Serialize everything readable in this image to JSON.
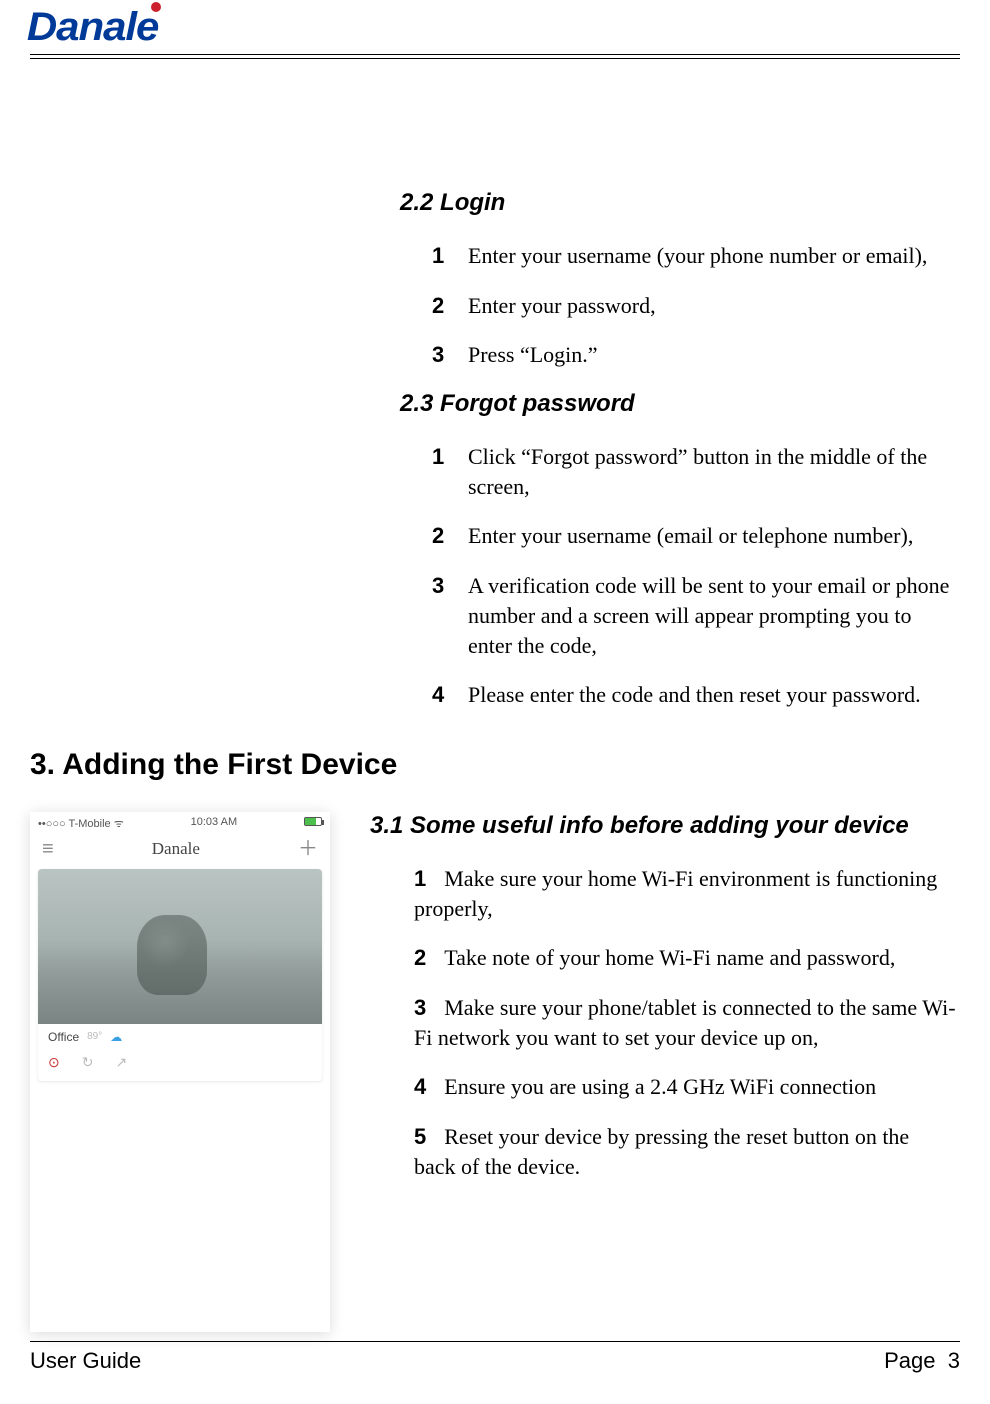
{
  "header": {
    "brand": "Danale"
  },
  "section22": {
    "heading": "2.2 Login",
    "items": [
      "Enter your username (your phone number or email),",
      "Enter your password,",
      "Press “Login.”"
    ]
  },
  "section23": {
    "heading": "2.3 Forgot password",
    "items": [
      "Click “Forgot password” button in the middle of the screen,",
      "Enter your username (email or telephone number),",
      "A verification code will be sent to your email or phone number and a screen will appear prompting you to enter the code,",
      "Please enter the code and then reset your password."
    ]
  },
  "section3": {
    "heading": "3. Adding the First Device"
  },
  "section31": {
    "heading": "3.1 Some useful info before adding your device",
    "items": [
      "Make sure your home Wi-Fi environment is functioning properly,",
      "Take note of your home Wi-Fi name and password,",
      "Make sure your phone/tablet is connected to the same Wi-Fi network you want to set your device up on,",
      "Ensure you are using a 2.4 GHz WiFi connection",
      "Reset your device by pressing the reset button on the back of the device."
    ]
  },
  "screenshot": {
    "carrier": "••○○○ T-Mobile",
    "wifi_glyph": "▴",
    "time": "10:03 AM",
    "app_title": "Danale",
    "card_label": "Office",
    "card_badge": "89°"
  },
  "footer": {
    "left": "User Guide",
    "right_label": "Page",
    "right_num": "3"
  }
}
